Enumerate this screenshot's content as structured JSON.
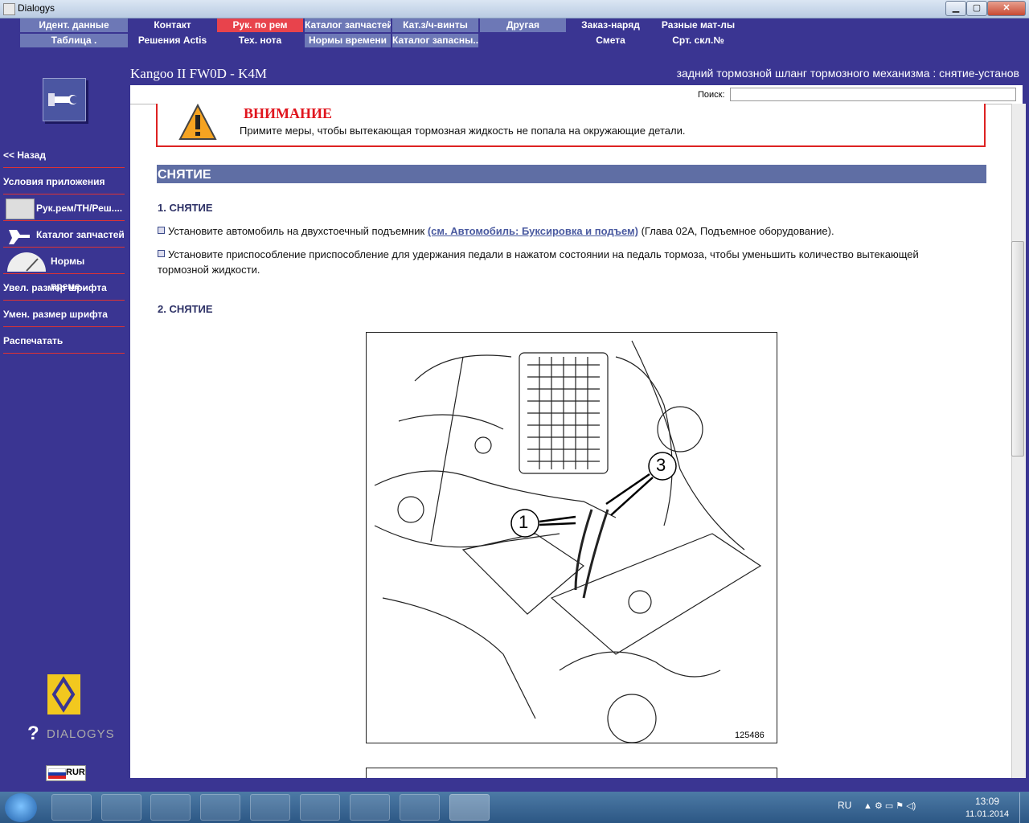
{
  "window": {
    "title": "Dialogys",
    "btn_min": "▁",
    "btn_max": "▢",
    "btn_close": "✕"
  },
  "menu": {
    "row1": [
      "Идент. данные",
      "Контакт",
      "Рук. по рем",
      "Каталог запчастей",
      "Кат.з/ч-винты",
      "Другая",
      "Заказ-наряд",
      "Разные мат-лы"
    ],
    "row2": [
      "Таблица .",
      "Решения Actis",
      "Тех. нота",
      "Нормы времени",
      "Каталог запасны...",
      "",
      "Смета",
      "Срт. скл.№"
    ]
  },
  "header": {
    "vehicle": "Kangoo II FW0D - K4M",
    "procedure": "задний тормозной шланг тормозного механизма : снятие-установ"
  },
  "search": {
    "label": "Поиск:",
    "value": ""
  },
  "sidebar": {
    "items": [
      "<< Назад",
      "Условия приложения",
      "Рук.рем/ТН/Реш....",
      "Каталог запчастей",
      "Нормы време...",
      "Увел. размер шрифта",
      "Умен. размер шрифта",
      "Распечатать"
    ],
    "brand": "DIALOGYS",
    "currency": "RUR"
  },
  "warning": {
    "title": "ВНИМАНИЕ",
    "text": "Примите меры, чтобы вытекающая тормозная жидкость не попала на окружающие детали."
  },
  "section": {
    "title": "СНЯТИЕ",
    "step1": "1. СНЯТИЕ",
    "p1_before": "Установите автомобиль на двухстоечный подъемник",
    "p1_link": "(см. Автомобиль: Буксировка и подъем)",
    "p1_after": "(Глава 02A, Подъемное оборудование).",
    "p2": "Установите приспособление приспособление для удержания педали в нажатом состоянии на педаль тормоза, чтобы уменьшить количество вытекающей тормозной жидкости.",
    "step2": "2. СНЯТИЕ"
  },
  "figure": {
    "callout1": "1",
    "callout3": "3",
    "number": "125486"
  },
  "taskbar": {
    "lang": "RU",
    "time": "13:09",
    "date": "11.01.2014"
  },
  "colors": {
    "bg": "#3a3592",
    "menu_light": "#6d78b6",
    "active": "#e8434c",
    "warning_red": "#e0151e",
    "section": "#5f6ea4"
  }
}
